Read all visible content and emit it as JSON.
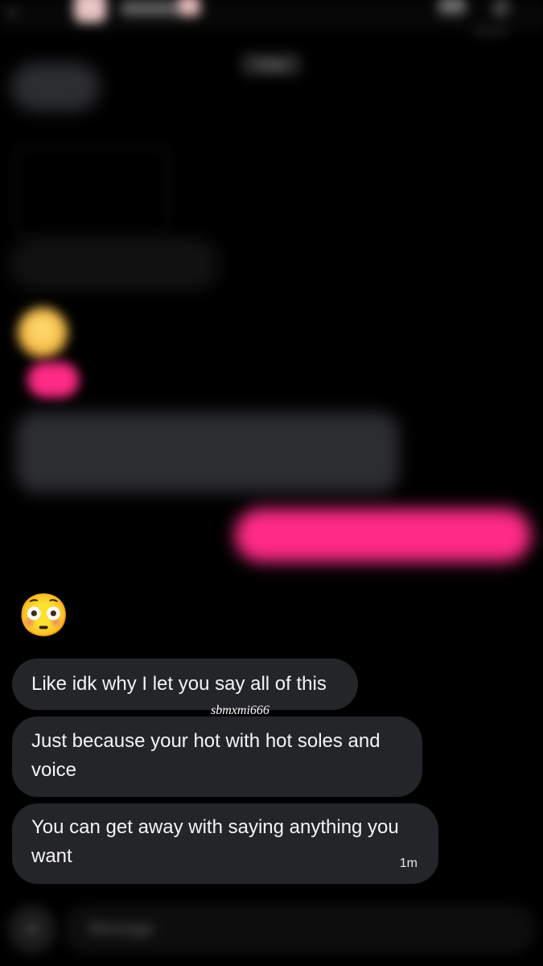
{
  "header": {
    "back_glyph": "←",
    "call_glyph": "✆",
    "contact_name": "",
    "icons": {
      "back": "back-arrow-icon",
      "video": "video-call-icon",
      "call": "phone-call-icon"
    }
  },
  "date_separator": "Today",
  "composer": {
    "plus_glyph": "+",
    "placeholder": "Message"
  },
  "messages": {
    "flushed_emoji": "😳",
    "m1": {
      "text": "Like idk why I let you say all of this"
    },
    "m2": {
      "text": "Just because your hot with hot soles and voice"
    },
    "m3": {
      "text": "You can get away with saying anything you want",
      "time": "1m"
    }
  },
  "watermark": "sbmxmi666",
  "colors": {
    "background": "#000000",
    "incoming_bubble": "#242529",
    "outgoing_bubble": "#ff2a86",
    "text": "#f4f4f4"
  }
}
